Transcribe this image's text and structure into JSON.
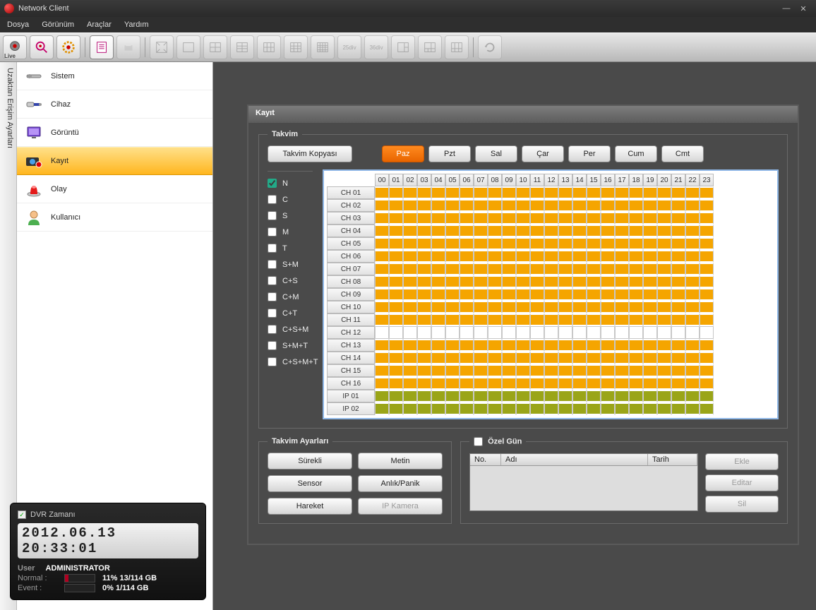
{
  "title": "Network Client",
  "menu": [
    "Dosya",
    "Görünüm",
    "Araçlar",
    "Yardım"
  ],
  "vtab": "Uzaktan Erişim Ayarları",
  "sidebar": [
    {
      "label": "Sistem",
      "icon": "wrench"
    },
    {
      "label": "Cihaz",
      "icon": "connector"
    },
    {
      "label": "Görüntü",
      "icon": "monitor"
    },
    {
      "label": "Kayıt",
      "icon": "camera",
      "active": true
    },
    {
      "label": "Olay",
      "icon": "beacon"
    },
    {
      "label": "Kullanıcı",
      "icon": "user"
    }
  ],
  "panel_title": "Kayıt",
  "takvim": {
    "legend": "Takvim",
    "copy_btn": "Takvim Kopyası",
    "days": [
      "Paz",
      "Pzt",
      "Sal",
      "Çar",
      "Per",
      "Cum",
      "Cmt"
    ],
    "active_day": "Paz"
  },
  "modes": [
    "N",
    "C",
    "S",
    "M",
    "T",
    "S+M",
    "C+S",
    "C+M",
    "C+T",
    "C+S+M",
    "S+M+T",
    "C+S+M+T"
  ],
  "mode_checked": "N",
  "hours": [
    "00",
    "01",
    "02",
    "03",
    "04",
    "05",
    "06",
    "07",
    "08",
    "09",
    "10",
    "11",
    "12",
    "13",
    "14",
    "15",
    "16",
    "17",
    "18",
    "19",
    "20",
    "21",
    "22",
    "23"
  ],
  "channels": [
    {
      "name": "CH 01",
      "type": "orange"
    },
    {
      "name": "CH 02",
      "type": "orange"
    },
    {
      "name": "CH 03",
      "type": "orange"
    },
    {
      "name": "CH 04",
      "type": "orange"
    },
    {
      "name": "CH 05",
      "type": "orange"
    },
    {
      "name": "CH 06",
      "type": "orange"
    },
    {
      "name": "CH 07",
      "type": "orange"
    },
    {
      "name": "CH 08",
      "type": "orange"
    },
    {
      "name": "CH 09",
      "type": "orange"
    },
    {
      "name": "CH 10",
      "type": "orange"
    },
    {
      "name": "CH 11",
      "type": "orange"
    },
    {
      "name": "CH 12",
      "type": "white"
    },
    {
      "name": "CH 13",
      "type": "orange"
    },
    {
      "name": "CH 14",
      "type": "orange"
    },
    {
      "name": "CH 15",
      "type": "orange"
    },
    {
      "name": "CH 16",
      "type": "orange"
    },
    {
      "name": "IP 01",
      "type": "olive"
    },
    {
      "name": "IP 02",
      "type": "olive"
    }
  ],
  "takvim_ayar": {
    "legend": "Takvim Ayarları",
    "buttons": [
      "Sürekli",
      "Metin",
      "Sensor",
      "Anlık/Panik",
      "Hareket",
      "IP Kamera"
    ],
    "disabled": [
      "IP Kamera"
    ]
  },
  "ozel_gun": {
    "legend": "Özel Gün",
    "cols": [
      "No.",
      "Adı",
      "Tarih"
    ],
    "buttons": [
      "Ekle",
      "Editar",
      "Sil"
    ]
  },
  "status": {
    "dvr_label": "DVR Zamanı",
    "clock": "2012.06.13 20:33:01",
    "user_label": "User",
    "user": "ADMINISTRATOR",
    "normal_label": "Normal :",
    "normal_text": "11% 13/114 GB",
    "normal_pct": 11,
    "event_label": "Event   :",
    "event_text": "0% 1/114 GB",
    "event_pct": 0
  },
  "toolbar_live": "Live"
}
